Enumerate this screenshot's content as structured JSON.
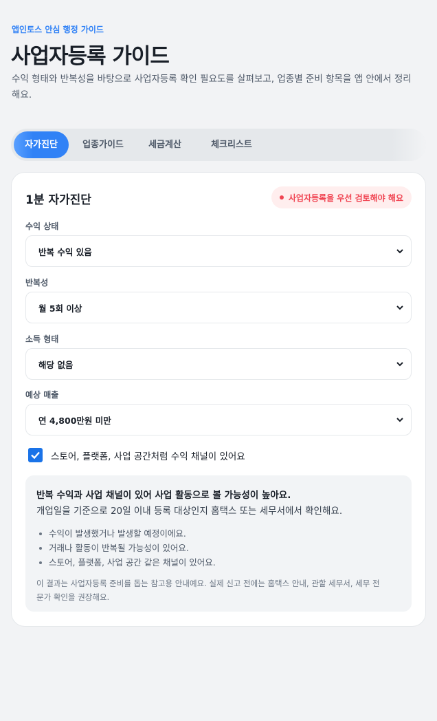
{
  "header": {
    "eyebrow": "앱인토스 안심 행정 가이드",
    "title": "사업자등록 가이드",
    "description": "수익 형태와 반복성을 바탕으로 사업자등록 확인 필요도를 살펴보고, 업종별 준비 항목을 앱 안에서 정리해요."
  },
  "tabs": [
    {
      "label": "자가진단",
      "active": true
    },
    {
      "label": "업종가이드",
      "active": false
    },
    {
      "label": "세금계산",
      "active": false
    },
    {
      "label": "체크리스트",
      "active": false
    }
  ],
  "card": {
    "title": "1분 자가진단",
    "badge": "사업자등록을 우선 검토해야 해요",
    "fields": [
      {
        "label": "수익 상태",
        "value": "반복 수익 있음"
      },
      {
        "label": "반복성",
        "value": "월 5회 이상"
      },
      {
        "label": "소득 형태",
        "value": "해당 없음"
      },
      {
        "label": "예상 매출",
        "value": "연 4,800만원 미만"
      }
    ],
    "checkbox": {
      "checked": true,
      "label": "스토어, 플랫폼, 사업 공간처럼 수익 채널이 있어요"
    },
    "result": {
      "headline": "반복 수익과 사업 채널이 있어 사업 활동으로 볼 가능성이 높아요.",
      "subline": "개업일을 기준으로 20일 이내 등록 대상인지 홈택스 또는 세무서에서 확인해요.",
      "bullets": [
        "수익이 발생했거나 발생할 예정이에요.",
        "거래나 활동이 반복될 가능성이 있어요.",
        "스토어, 플랫폼, 사업 공간 같은 채널이 있어요."
      ],
      "note": "이 결과는 사업자등록 준비를 돕는 참고용 안내예요. 실제 신고 전에는 홈택스 안내, 관할 세무서, 세무 전문가 확인을 권장해요."
    }
  },
  "colors": {
    "accent": "#3182f6",
    "danger": "#f04452",
    "checkbox": "#1a73e8"
  }
}
